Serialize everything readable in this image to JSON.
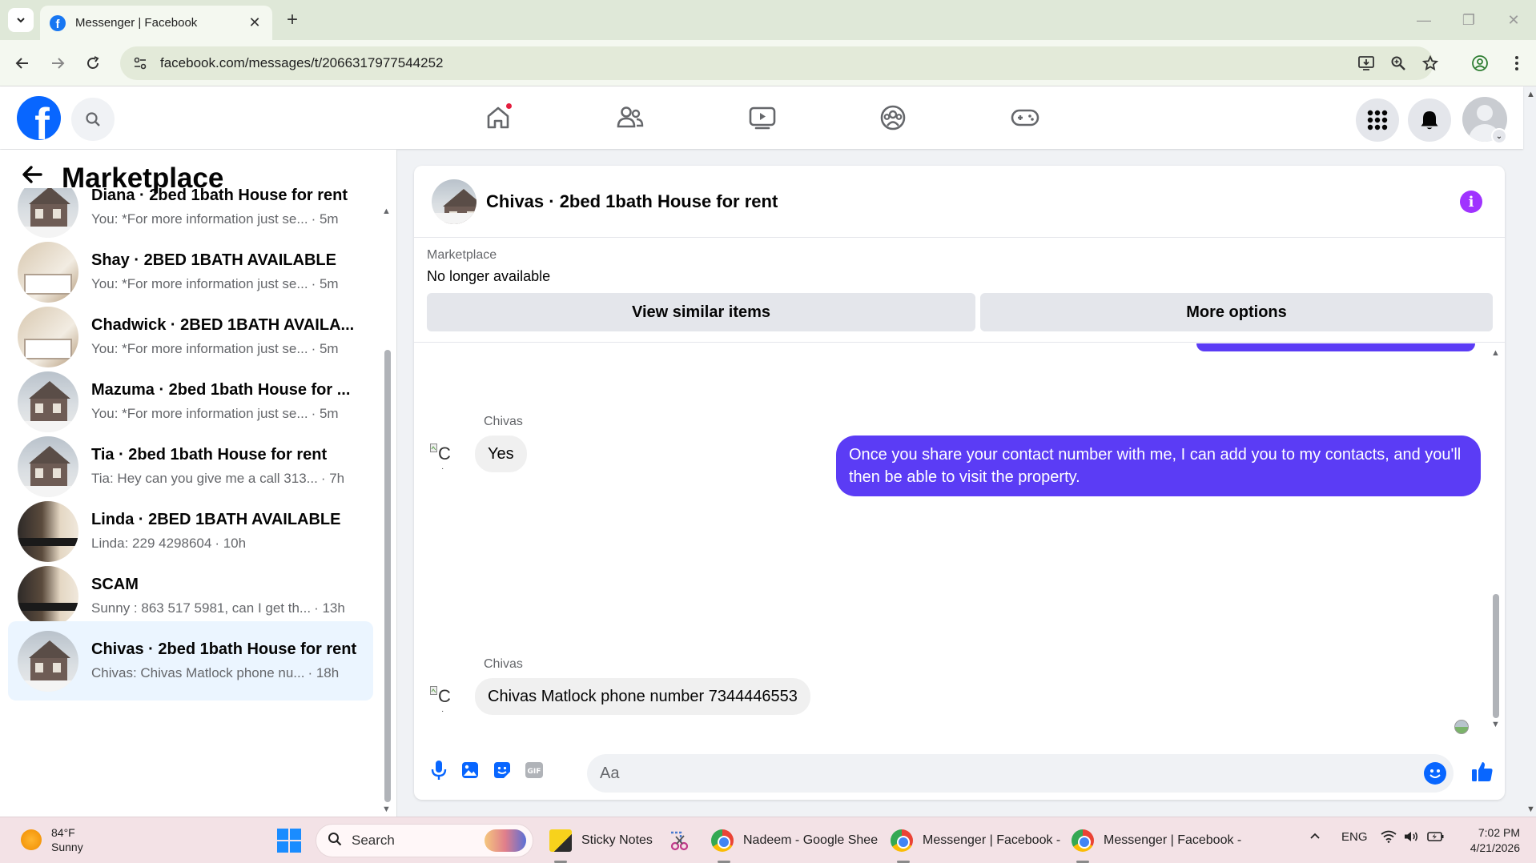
{
  "browser": {
    "tab_title": "Messenger | Facebook",
    "url": "facebook.com/messages/t/2066317977544252"
  },
  "header": {
    "home_has_notification": true
  },
  "sidebar": {
    "title": "Marketplace",
    "conversations": [
      {
        "name": "Diana · 2bed 1bath House for rent",
        "snippet": "You: *For more information just se...",
        "time": "· 5m",
        "thumb": "house"
      },
      {
        "name": "Shay · 2BED 1BATH AVAILABLE",
        "snippet": "You: *For more information just se...",
        "time": "· 5m",
        "thumb": "room"
      },
      {
        "name": "Chadwick · 2BED 1BATH AVAILA...",
        "snippet": "You: *For more information just se...",
        "time": "· 5m",
        "thumb": "room"
      },
      {
        "name": "Mazuma · 2bed 1bath House for ...",
        "snippet": "You: *For more information just se...",
        "time": "· 5m",
        "thumb": "house"
      },
      {
        "name": "Tia · 2bed 1bath House for rent",
        "snippet": "Tia: Hey can you give me a call 313...",
        "time": "· 7h",
        "thumb": "house"
      },
      {
        "name": "Linda · 2BED 1BATH AVAILABLE",
        "snippet": "Linda: 229 4298604",
        "time": "· 10h",
        "thumb": "kitchen"
      },
      {
        "name": "SCAM",
        "snippet": "Sunny : 863 517 5981, can I get th...",
        "time": "· 13h",
        "thumb": "kitchen"
      },
      {
        "name": "Chivas · 2bed 1bath House for rent",
        "snippet": "Chivas: Chivas Matlock phone nu...",
        "time": "· 18h",
        "thumb": "house",
        "active": true
      }
    ]
  },
  "chat": {
    "title": "Chivas · 2bed 1bath House for rent",
    "marketplace_label": "Marketplace",
    "listing_status": "No longer available",
    "view_similar_label": "View similar items",
    "more_options_label": "More options",
    "messages": [
      {
        "sender": "Chivas",
        "avatar_alt": "C",
        "text": "Yes",
        "direction": "in"
      },
      {
        "text": "Once you share your contact number with me, I can add you to my contacts, and you'll then be able to visit the property.",
        "direction": "out"
      },
      {
        "sender": "Chivas",
        "avatar_alt": "C",
        "text": "Chivas Matlock phone number 7344446553",
        "direction": "in"
      }
    ],
    "composer_placeholder": "Aa",
    "accent_color": "#5b3cf5"
  },
  "taskbar": {
    "weather_temp": "84°F",
    "weather_desc": "Sunny",
    "search_label": "Search",
    "apps": [
      {
        "label": "Sticky Notes"
      },
      {
        "label": "Nadeem - Google Shee"
      },
      {
        "label": "Messenger | Facebook -"
      },
      {
        "label": "Messenger | Facebook -"
      }
    ],
    "language": "ENG",
    "time": "7:02 PM",
    "date": "4/21/2026"
  }
}
